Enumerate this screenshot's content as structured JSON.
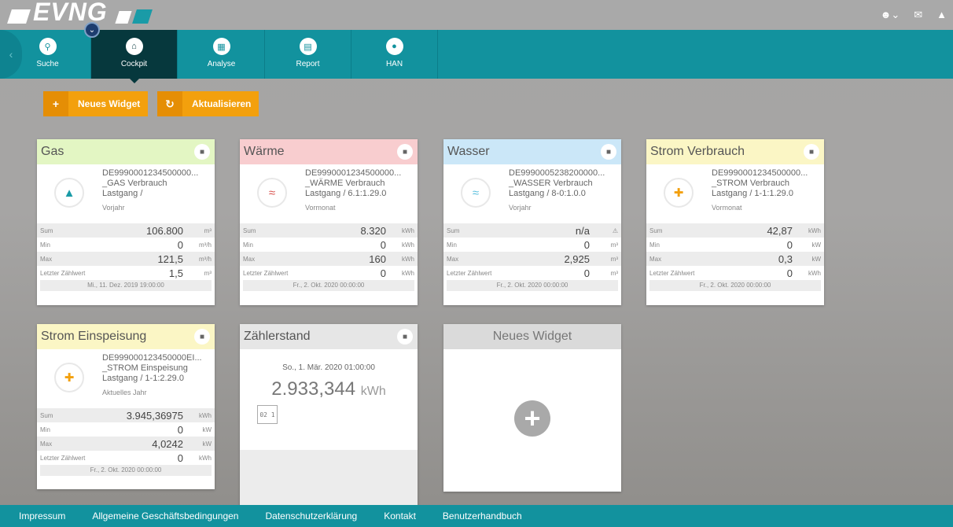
{
  "brand": {
    "logo_text": "EVNG",
    "logo_icon": "evng-logo"
  },
  "top_icons": [
    "user-icon",
    "envelope-icon",
    "graduation-cap-icon"
  ],
  "nav": {
    "items": [
      {
        "label": "Suche",
        "icon": "search-icon"
      },
      {
        "label": "Cockpit",
        "icon": "home-icon"
      },
      {
        "label": "Analyse",
        "icon": "chart-icon"
      },
      {
        "label": "Report",
        "icon": "document-icon"
      },
      {
        "label": "HAN",
        "icon": "lock-icon"
      }
    ],
    "active_index": 1
  },
  "actions": {
    "new_widget": "Neues Widget",
    "refresh": "Aktualisieren"
  },
  "widgets": {
    "gas": {
      "title": "Gas",
      "line1": "DE9990001234500000...",
      "line2": "_GAS Verbrauch",
      "line3": "Lastgang /",
      "period": "Vorjahr",
      "sum_label": "Sum",
      "sum": "106.800",
      "sum_unit": "m³",
      "min_label": "Min",
      "min": "0",
      "min_unit": "m³/h",
      "max_label": "Max",
      "max": "121,5",
      "max_unit": "m³/h",
      "last_label": "Letzter Zählwert",
      "last": "1,5",
      "last_unit": "m³",
      "date": "Mi., 11. Dez. 2019 19:00:00",
      "accent": "#e3f6c3"
    },
    "waerme": {
      "title": "Wärme",
      "line1": "DE9990001234500000...",
      "line2": "_WÄRME Verbrauch",
      "line3": "Lastgang / 6.1:1.29.0",
      "period": "Vormonat",
      "sum_label": "Sum",
      "sum": "8.320",
      "sum_unit": "kWh",
      "min_label": "Min",
      "min": "0",
      "min_unit": "kWh",
      "max_label": "Max",
      "max": "160",
      "max_unit": "kWh",
      "last_label": "Letzter Zählwert",
      "last": "0",
      "last_unit": "kWh",
      "date": "Fr., 2. Okt. 2020 00:00:00",
      "accent": "#f8cdcf"
    },
    "wasser": {
      "title": "Wasser",
      "line1": "DE9990005238200000...",
      "line2": "_WASSER Verbrauch",
      "line3": "Lastgang / 8-0:1.0.0",
      "period": "Vorjahr",
      "sum_label": "Sum",
      "sum": "n/a",
      "sum_unit": "⚠",
      "min_label": "Min",
      "min": "0",
      "min_unit": "m³",
      "max_label": "Max",
      "max": "2,925",
      "max_unit": "m³",
      "last_label": "Letzter Zählwert",
      "last": "0",
      "last_unit": "m³",
      "date": "Fr., 2. Okt. 2020 00:00:00",
      "accent": "#cbe7f8"
    },
    "strom_verbrauch": {
      "title": "Strom Verbrauch",
      "line1": "DE9990001234500000...",
      "line2": "_STROM Verbrauch",
      "line3": "Lastgang / 1-1:1.29.0",
      "period": "Vormonat",
      "sum_label": "Sum",
      "sum": "42,87",
      "sum_unit": "kWh",
      "min_label": "Min",
      "min": "0",
      "min_unit": "kW",
      "max_label": "Max",
      "max": "0,3",
      "max_unit": "kW",
      "last_label": "Letzter Zählwert",
      "last": "0",
      "last_unit": "kWh",
      "date": "Fr., 2. Okt. 2020 00:00:00",
      "accent": "#fbf6c5"
    },
    "strom_einspeisung": {
      "title": "Strom Einspeisung",
      "line1": "DE999000123450000EI...",
      "line2": "_STROM Einspeisung",
      "line3": "Lastgang / 1-1:2.29.0",
      "period": "Aktuelles Jahr",
      "sum_label": "Sum",
      "sum": "3.945,36975",
      "sum_unit": "kWh",
      "min_label": "Min",
      "min": "0",
      "min_unit": "kW",
      "max_label": "Max",
      "max": "4,0242",
      "max_unit": "kW",
      "last_label": "Letzter Zählwert",
      "last": "0",
      "last_unit": "kWh",
      "date": "Fr., 2. Okt. 2020 00:00:00",
      "accent": "#fbf6c5"
    },
    "zaehlerstand": {
      "title": "Zählerstand",
      "date": "So., 1. Mär. 2020 01:00:00",
      "value": "2.933,344",
      "unit": "kWh",
      "meter_digits": "02 1"
    },
    "new_widget": {
      "title": "Neues Widget"
    }
  },
  "footer": {
    "links": [
      "Impressum",
      "Allgemeine Geschäftsbedingungen",
      "Datenschutzerklärung",
      "Kontakt",
      "Benutzerhandbuch"
    ]
  },
  "colors": {
    "teal": "#12929e",
    "active_nav": "#06383d",
    "orange": "#f3a00d",
    "footer": "#12929e"
  }
}
